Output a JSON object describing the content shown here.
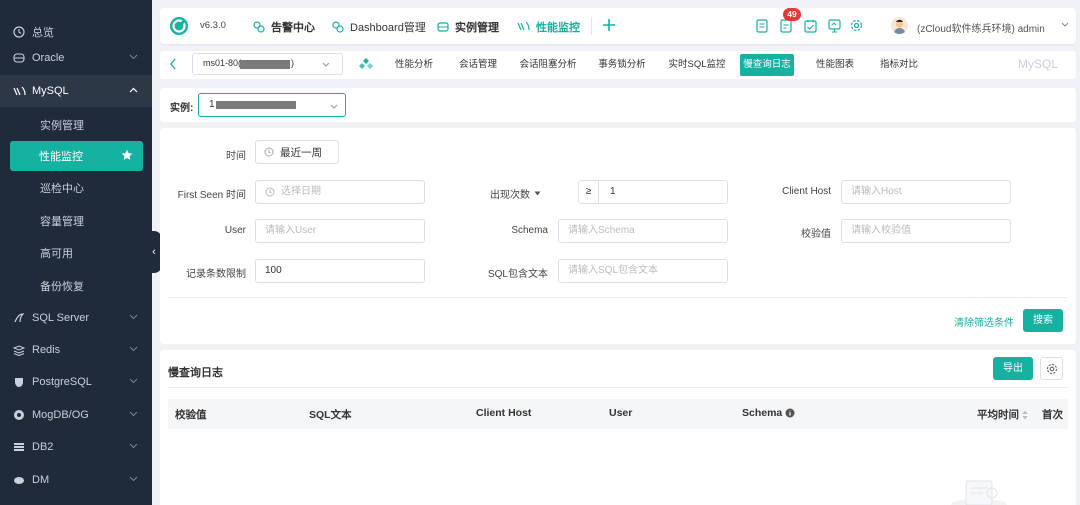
{
  "sidebar": {
    "items": [
      {
        "label": "总览",
        "icon": "clock-icon"
      },
      {
        "label": "Oracle",
        "icon": "database-icon"
      },
      {
        "label": "MySQL",
        "icon": "mysql-icon"
      },
      {
        "label": "SQL Server",
        "icon": "sqlserver-icon"
      },
      {
        "label": "Redis",
        "icon": "redis-icon"
      },
      {
        "label": "PostgreSQL",
        "icon": "postgresql-icon"
      },
      {
        "label": "MogDB/OG",
        "icon": "mogdb-icon"
      },
      {
        "label": "DB2",
        "icon": "db2-icon"
      },
      {
        "label": "DM",
        "icon": "dm-icon"
      }
    ],
    "mysql_sub": [
      "实例管理",
      "性能监控",
      "巡检中心",
      "容量管理",
      "高可用",
      "备份恢复"
    ]
  },
  "topbar": {
    "version": "v6.3.0",
    "nav": [
      "告警中心",
      "Dashboard管理",
      "实例管理",
      "性能监控"
    ],
    "badge": "49",
    "user": "(zCloud软件练兵环境) admin"
  },
  "tabbar": {
    "instance": "ms01-80(",
    "instance_suffix": ")",
    "tabs": [
      "性能分析",
      "会话管理",
      "会话阻塞分析",
      "事务锁分析",
      "实时SQL监控",
      "慢查询日志",
      "性能图表",
      "指标对比"
    ],
    "active": "慢查询日志",
    "db_label": "MySQL"
  },
  "instance_bar": {
    "label": "实例:",
    "value": "1"
  },
  "filters": {
    "time_label": "时间",
    "time_value": "最近一周",
    "first_seen_label": "First Seen 时间",
    "first_seen_placeholder": "选择日期",
    "count_label": "出现次数",
    "count_op": "≥",
    "count_value": "1",
    "client_host_label": "Client Host",
    "client_host_placeholder": "请输入Host",
    "user_label": "User",
    "user_placeholder": "请输入User",
    "schema_label": "Schema",
    "schema_placeholder": "请输入Schema",
    "checksum_label": "校验值",
    "checksum_placeholder": "请输入校验值",
    "limit_label": "记录条数限制",
    "limit_value": "100",
    "sql_text_label": "SQL包含文本",
    "sql_text_placeholder": "请输入SQL包含文本",
    "clear_label": "清除筛选条件",
    "search_label": "搜索"
  },
  "results": {
    "title": "慢查询日志",
    "export_label": "导出",
    "columns": [
      "校验值",
      "SQL文本",
      "Client Host",
      "User",
      "Schema",
      "平均时间",
      "首次"
    ]
  },
  "colors": {
    "accent": "#16b2a1",
    "sidebar": "#1f2a3a",
    "badge": "#e53935"
  }
}
